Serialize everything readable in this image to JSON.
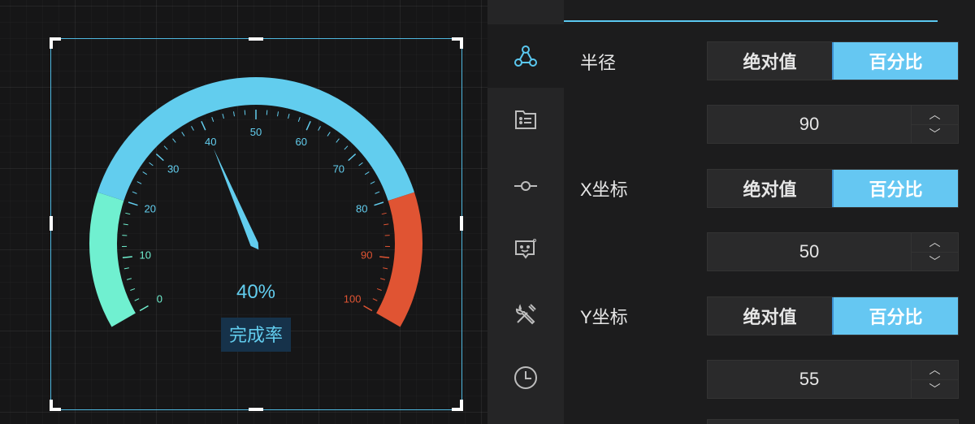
{
  "gauge": {
    "min": 0,
    "max": 100,
    "value": 40,
    "value_text": "40%",
    "label": "完成率",
    "tick_labels": [
      "0",
      "10",
      "20",
      "30",
      "40",
      "50",
      "60",
      "70",
      "80",
      "90",
      "100"
    ],
    "segments": [
      {
        "from": 0,
        "to": 20,
        "color": "#70f0d0"
      },
      {
        "from": 20,
        "to": 80,
        "color": "#62cdee"
      },
      {
        "from": 80,
        "to": 100,
        "color": "#e05433"
      }
    ],
    "tick_colors": {
      "low": "#70f0d0",
      "mid": "#62cdee",
      "high": "#e05433"
    },
    "pointer_color": "#62cdee"
  },
  "rail": {
    "items": [
      {
        "icon": "nodes-icon",
        "active": true
      },
      {
        "icon": "list-folder-icon",
        "active": false
      },
      {
        "icon": "commit-icon",
        "active": false
      },
      {
        "icon": "message-smile-icon",
        "active": false
      },
      {
        "icon": "tools-icon",
        "active": false
      },
      {
        "icon": "clock-icon",
        "active": false
      }
    ],
    "active_color": "#5ac8f0",
    "icon_color": "#bdbdbd"
  },
  "panel": {
    "radius": {
      "label": "半径",
      "opt_abs": "绝对值",
      "opt_pct": "百分比",
      "value": "90"
    },
    "x": {
      "label": "X坐标",
      "opt_abs": "绝对值",
      "opt_pct": "百分比",
      "value": "50"
    },
    "y": {
      "label": "Y坐标",
      "opt_abs": "绝对值",
      "opt_pct": "百分比",
      "value": "55"
    },
    "up_glyph": "︿",
    "down_glyph": "﹀"
  }
}
